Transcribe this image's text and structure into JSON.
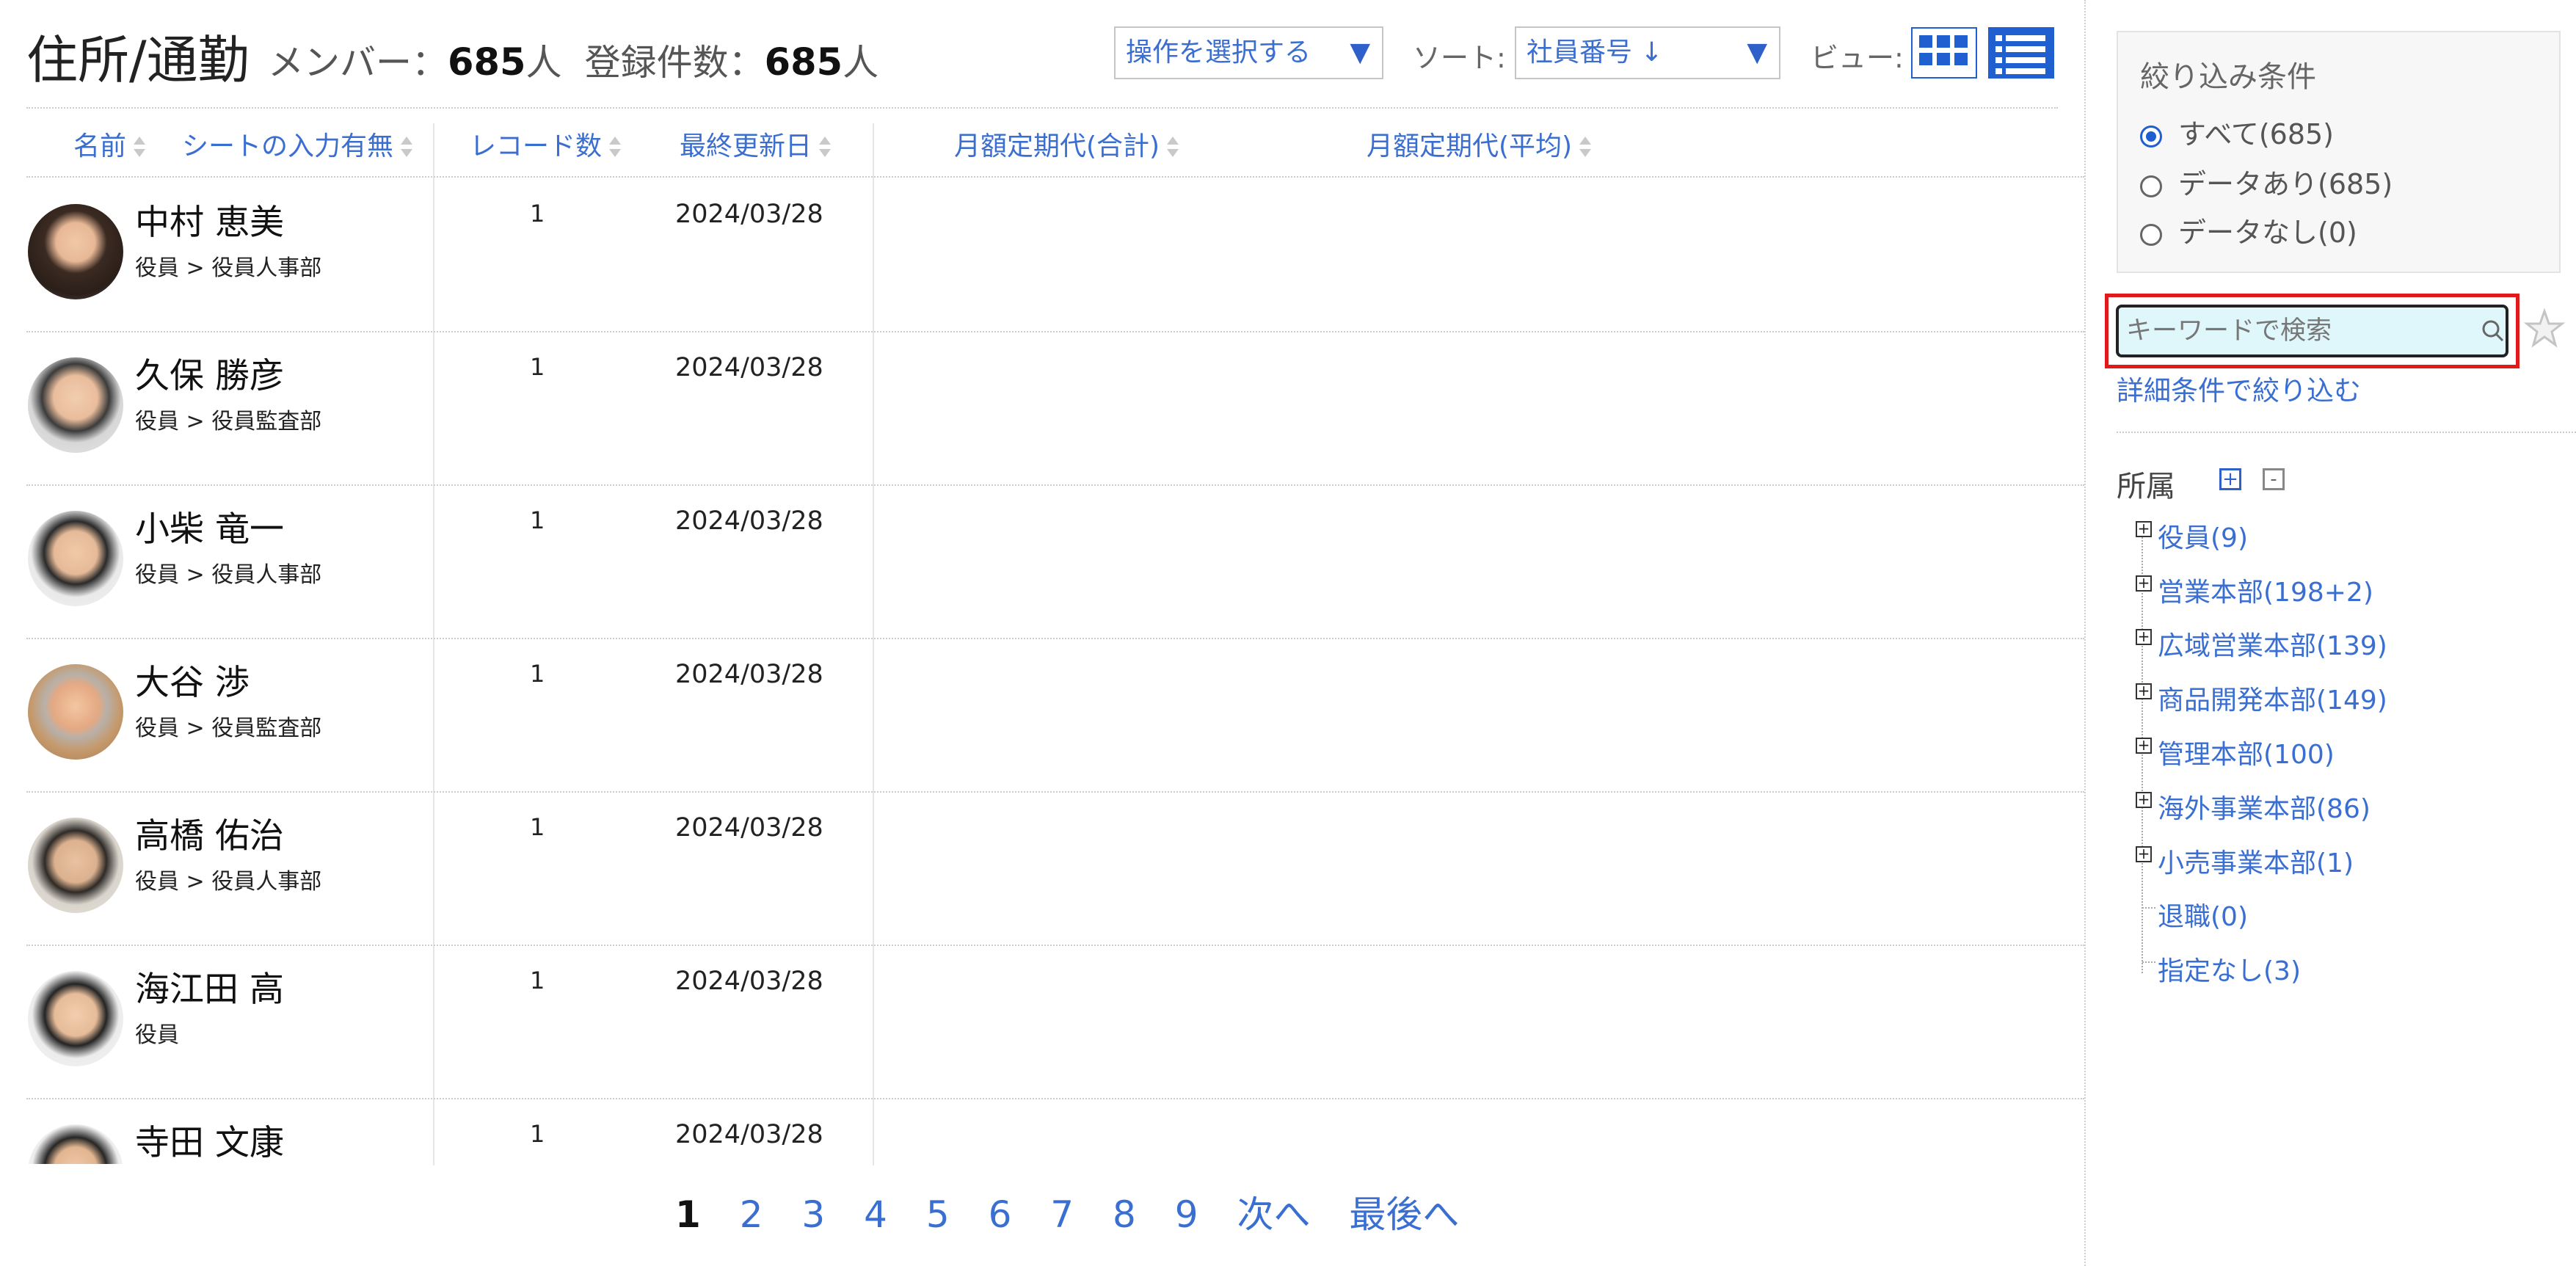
{
  "header": {
    "title": "住所/通勤",
    "members_label": "メンバー：",
    "members_count": "685",
    "members_unit": "人",
    "registered_label": "登録件数：",
    "registered_count": "685",
    "registered_unit": "人"
  },
  "toolbar": {
    "action_select": "操作を選択する",
    "sort_label": "ソート:",
    "sort_select": "社員番号 ↓",
    "view_label": "ビュー:",
    "accent_color": "#1f5fd0"
  },
  "table": {
    "columns": [
      "名前",
      "シートの入力有無",
      "レコード数",
      "最終更新日",
      "月額定期代(合計)",
      "月額定期代(平均)"
    ],
    "rows": [
      {
        "name": "中村 恵美",
        "dept": "役員 > 役員人事部",
        "records": "1",
        "updated": "2024/03/28"
      },
      {
        "name": "久保 勝彦",
        "dept": "役員 > 役員監査部",
        "records": "1",
        "updated": "2024/03/28"
      },
      {
        "name": "小柴 竜一",
        "dept": "役員 > 役員人事部",
        "records": "1",
        "updated": "2024/03/28"
      },
      {
        "name": "大谷 渉",
        "dept": "役員 > 役員監査部",
        "records": "1",
        "updated": "2024/03/28"
      },
      {
        "name": "高橋 佑治",
        "dept": "役員 > 役員人事部",
        "records": "1",
        "updated": "2024/03/28"
      },
      {
        "name": "海江田 高",
        "dept": "役員",
        "records": "1",
        "updated": "2024/03/28"
      },
      {
        "name": "寺田 文康",
        "dept": "",
        "records": "1",
        "updated": "2024/03/28"
      }
    ]
  },
  "pager": {
    "pages": [
      "1",
      "2",
      "3",
      "4",
      "5",
      "6",
      "7",
      "8",
      "9"
    ],
    "current": "1",
    "next": "次へ",
    "last": "最後へ"
  },
  "sidebar": {
    "filter_title": "絞り込み条件",
    "radios": [
      {
        "label": "すべて(685)",
        "selected": true
      },
      {
        "label": "データあり(685)",
        "selected": false
      },
      {
        "label": "データなし(0)",
        "selected": false
      }
    ],
    "search_placeholder": "キーワードで検索",
    "advanced_link": "詳細条件で絞り込む",
    "dept_title": "所属",
    "expand_all": "+",
    "collapse_all": "-",
    "tree": [
      {
        "label": "役員(9)",
        "expandable": true
      },
      {
        "label": "営業本部(198+2)",
        "expandable": true
      },
      {
        "label": "広域営業本部(139)",
        "expandable": true
      },
      {
        "label": "商品開発本部(149)",
        "expandable": true
      },
      {
        "label": "管理本部(100)",
        "expandable": true
      },
      {
        "label": "海外事業本部(86)",
        "expandable": true
      },
      {
        "label": "小売事業本部(1)",
        "expandable": true
      },
      {
        "label": "退職(0)",
        "expandable": false
      },
      {
        "label": "指定なし(3)",
        "expandable": false
      }
    ],
    "highlight_color": "#e01a1a"
  }
}
